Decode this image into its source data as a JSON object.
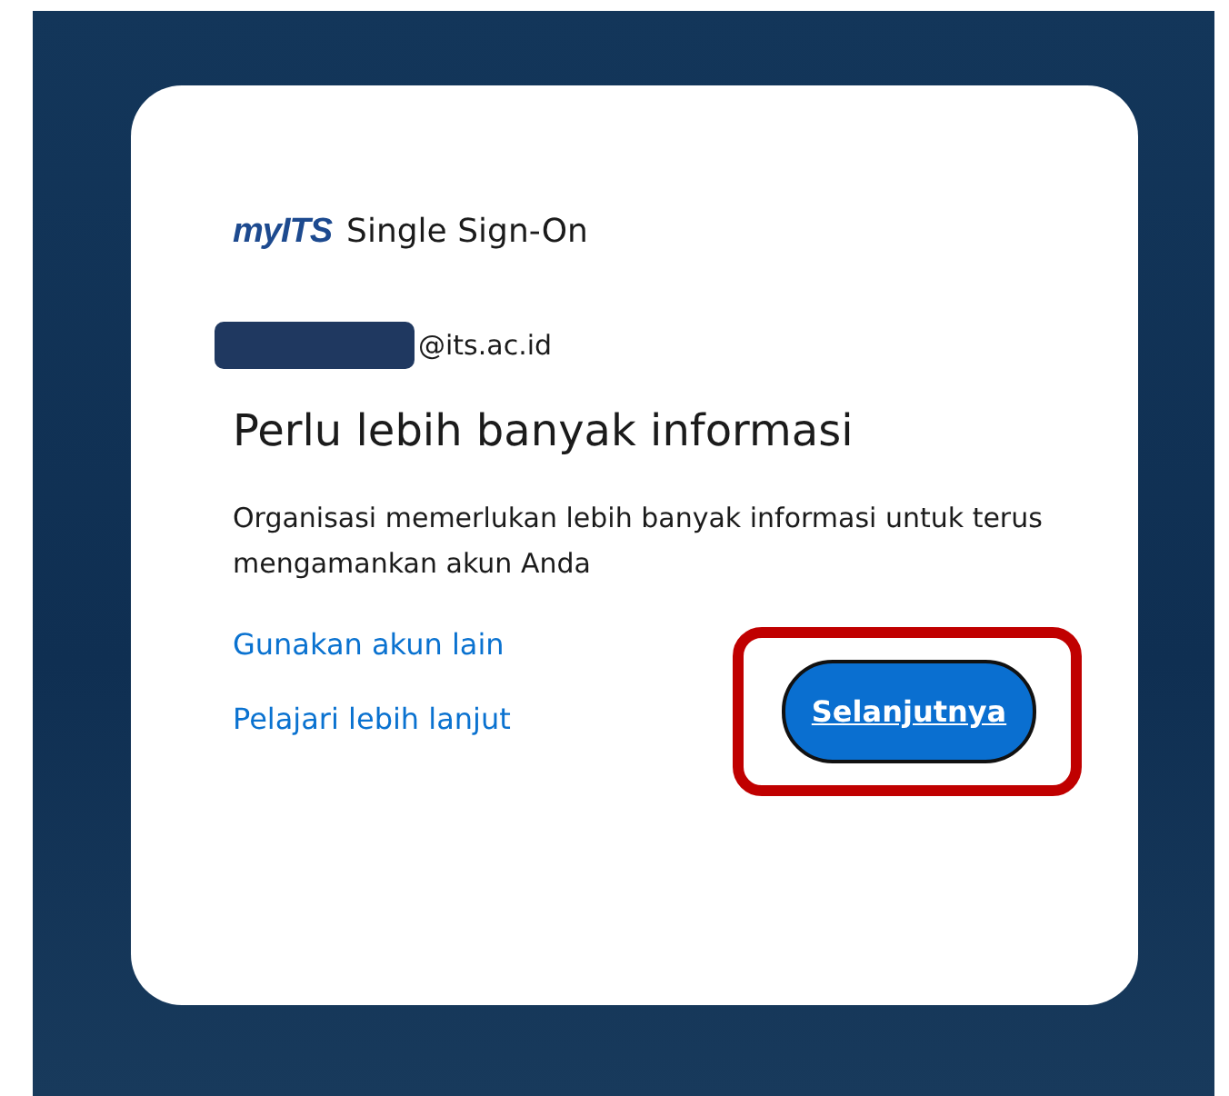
{
  "logo": {
    "brand": "myITS",
    "product": "Single Sign-On"
  },
  "account": {
    "email_suffix": "@its.ac.id"
  },
  "heading": "Perlu lebih banyak informasi",
  "description": "Organisasi memerlukan lebih banyak informasi untuk terus mengamankan akun Anda",
  "links": [
    "Gunakan akun lain",
    "Pelajari lebih lanjut"
  ],
  "next_button": {
    "label": "Selanjutnya",
    "highlighted": true
  }
}
